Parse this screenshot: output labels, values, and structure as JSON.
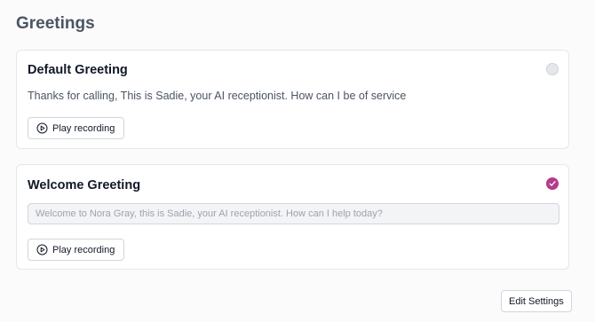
{
  "page": {
    "title": "Greetings"
  },
  "greetings": [
    {
      "title": "Default Greeting",
      "message": "Thanks for calling, This is Sadie, your AI receptionist. How can I be of service",
      "selected": false,
      "play_label": "Play recording",
      "play_icon": "play-circle-icon"
    },
    {
      "title": "Welcome Greeting",
      "placeholder": "Welcome to Nora Gray, this is Sadie, your AI receptionist. How can I help today?",
      "selected": true,
      "play_label": "Play recording",
      "play_icon": "play-circle-icon",
      "check_icon": "check-icon"
    }
  ],
  "footer": {
    "edit_label": "Edit Settings"
  },
  "colors": {
    "accent": "#b43b8c",
    "border": "#e5e7eb",
    "title": "#4b5563"
  }
}
